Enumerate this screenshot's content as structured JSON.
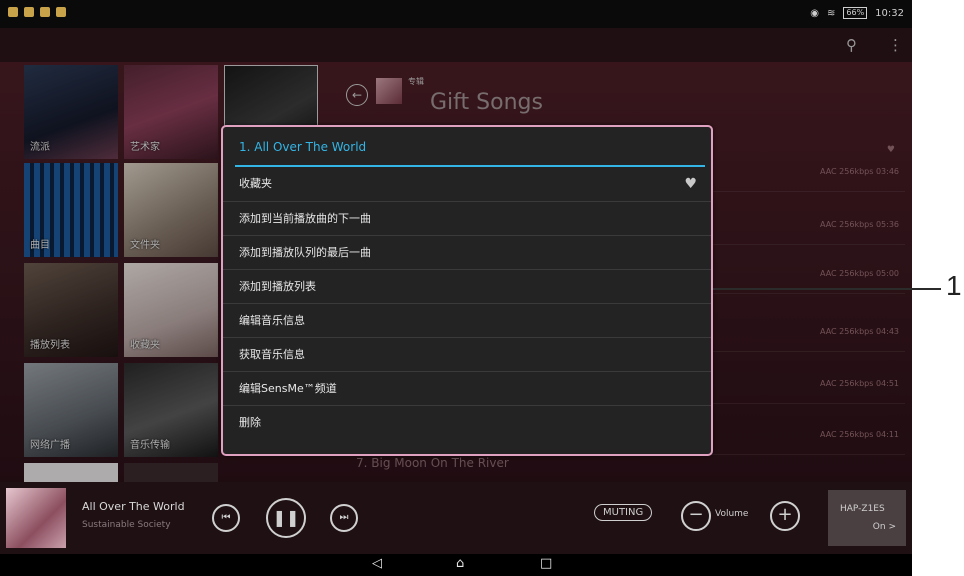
{
  "status_bar": {
    "time": "10:32",
    "battery": "66%"
  },
  "album": {
    "type": "专辑",
    "title": "Gift Songs"
  },
  "grid": [
    {
      "label": "流派"
    },
    {
      "label": "艺术家"
    },
    {
      "label": "曲目"
    },
    {
      "label": "文件夹"
    },
    {
      "label": "播放列表"
    },
    {
      "label": "收藏夹"
    },
    {
      "label": "网络广播"
    },
    {
      "label": "音乐传输"
    }
  ],
  "tracks": [
    {
      "meta": "AAC 256kbps  03:46"
    },
    {
      "meta": "AAC 256kbps  05:36"
    },
    {
      "meta": "AAC 256kbps  05:00"
    },
    {
      "meta": "AAC 256kbps  04:43"
    },
    {
      "meta": "AAC 256kbps  04:51"
    },
    {
      "meta": "AAC 256kbps  04:11"
    }
  ],
  "track7": "7. Big Moon On The River",
  "menu": {
    "header": "1. All Over The World",
    "items": [
      {
        "label": "收藏夹"
      },
      {
        "label": "添加到当前播放曲的下一曲"
      },
      {
        "label": "添加到播放队列的最后一曲"
      },
      {
        "label": "添加到播放列表"
      },
      {
        "label": "编辑音乐信息"
      },
      {
        "label": "获取音乐信息"
      },
      {
        "label": "编辑SensMe™频道"
      },
      {
        "label": "删除"
      }
    ]
  },
  "callout": "1",
  "player": {
    "song": "All Over The World",
    "artist": "Sustainable Society",
    "muting": "MUTING",
    "volume": "Volume",
    "device": "HAP-Z1ES",
    "device_status": "On >"
  },
  "icons": {
    "search": "search-icon",
    "more": "more-vert-icon",
    "back": "back-arrow-icon",
    "heart": "heart-icon",
    "prev": "prev-icon",
    "pause": "pause-icon",
    "next": "next-icon"
  }
}
